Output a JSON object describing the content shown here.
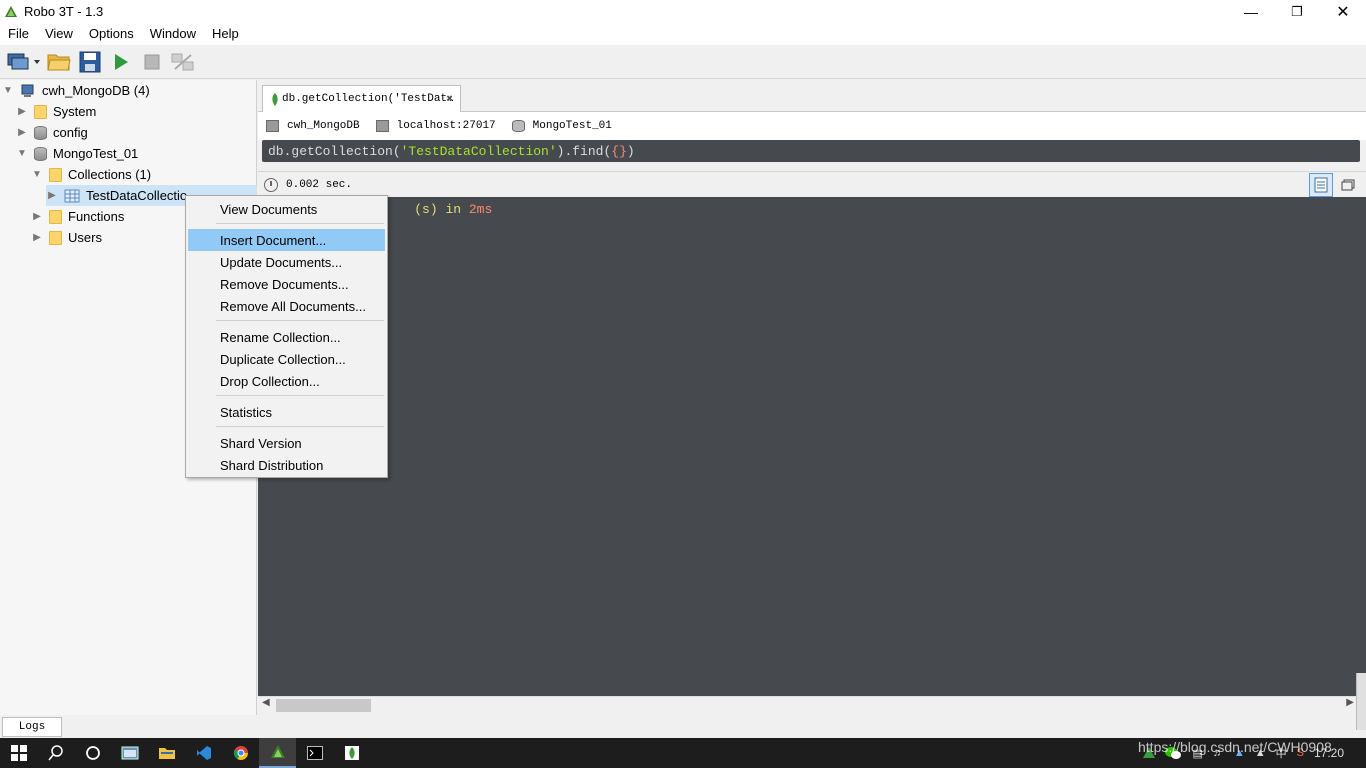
{
  "window": {
    "title": "Robo 3T - 1.3"
  },
  "menu": [
    "File",
    "View",
    "Options",
    "Window",
    "Help"
  ],
  "toolbar": {
    "icons": [
      "connect-icon",
      "open-icon",
      "save-icon",
      "execute-icon",
      "stop-icon",
      "orientation-icon"
    ]
  },
  "explorer": {
    "connection": "cwh_MongoDB (4)",
    "system": "System",
    "config": "config",
    "database": "MongoTest_01",
    "collections": "Collections (1)",
    "collection": "TestDataCollectio",
    "functions": "Functions",
    "users": "Users"
  },
  "tab": {
    "label": "db.getCollection('TestDat…"
  },
  "info": {
    "connection": "cwh_MongoDB",
    "host": "localhost:27017",
    "db": "MongoTest_01"
  },
  "editor": {
    "p1": "db.getCollection(",
    "p2": "'TestDataCollection'",
    "p3": ").find(",
    "p4": "{}",
    "p5": ")"
  },
  "results": {
    "time": "0.002 sec.",
    "fragment": "(s) in ",
    "ms": "2ms"
  },
  "logs": "Logs",
  "context_menu": {
    "view_documents": "View Documents",
    "insert_document": "Insert Document...",
    "update_documents": "Update Documents...",
    "remove_documents": "Remove Documents...",
    "remove_all_documents": "Remove All Documents...",
    "rename_collection": "Rename Collection...",
    "duplicate_collection": "Duplicate Collection...",
    "drop_collection": "Drop Collection...",
    "statistics": "Statistics",
    "shard_version": "Shard Version",
    "shard_distribution": "Shard Distribution"
  },
  "taskbar": {
    "watermark": "https://blog.csdn.net/CWH0908",
    "clock": "17:20"
  },
  "colors": {
    "accent": "#91c9f7",
    "editor_bg": "#46494d",
    "string": "#a6e22e",
    "number": "#f78c6c"
  }
}
